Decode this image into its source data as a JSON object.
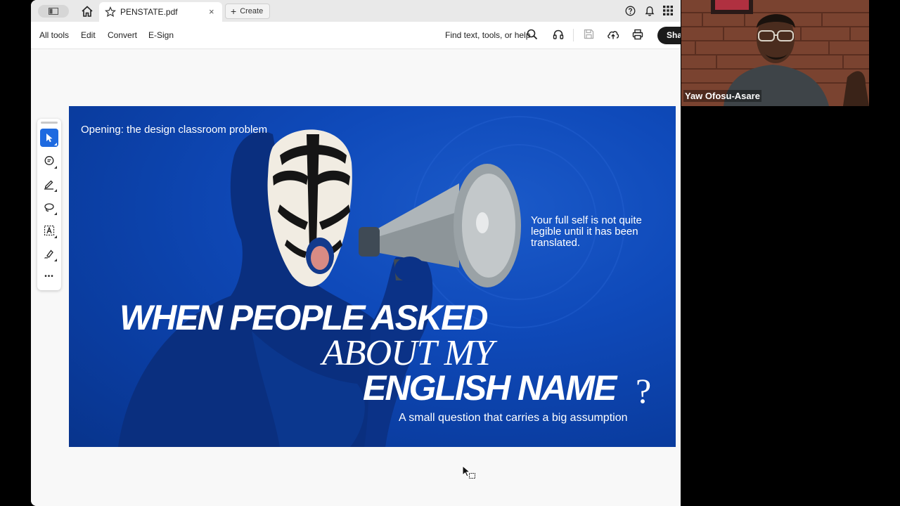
{
  "tabbar": {
    "document_tab_title": "PENSTATE.pdf",
    "close_symbol": "×",
    "create_label": "Create",
    "icons": [
      "sidebar-toggle-icon",
      "home-icon",
      "star-icon",
      "help-icon",
      "bell-icon",
      "apps-grid-icon"
    ]
  },
  "toolbar": {
    "menu": [
      "All tools",
      "Edit",
      "Convert",
      "E-Sign"
    ],
    "find_label": "Find text, tools, or help",
    "share_label": "Sha",
    "icons": [
      "search-icon",
      "read-aloud-icon",
      "save-icon",
      "upload-icon",
      "print-icon"
    ]
  },
  "quick_tools": {
    "tools": [
      "select-tool-icon",
      "comment-tool-icon",
      "highlight-tool-icon",
      "draw-tool-icon",
      "text-select-tool-icon",
      "sign-tool-icon",
      "more-tools-icon"
    ],
    "more_symbol": "•••",
    "active_tool": "select-tool-icon"
  },
  "slide": {
    "kicker": "Opening: the design classroom problem",
    "quote": "Your full self is not quite legible until it has been translated.",
    "headline_line1": "WHEN PEOPLE ASKED",
    "headline_line2": "ABOUT MY",
    "headline_line3": "ENGLISH NAME",
    "headline_mark": "?",
    "subtitle": "A small question that carries a big assumption",
    "colors": {
      "background": "#0f4aba",
      "text": "#ffffff"
    }
  },
  "participant": {
    "name": "Yaw Ofosu-Asare"
  },
  "colors": {
    "accent": "#1e6ae0",
    "share_button": "#1b1b1b"
  }
}
